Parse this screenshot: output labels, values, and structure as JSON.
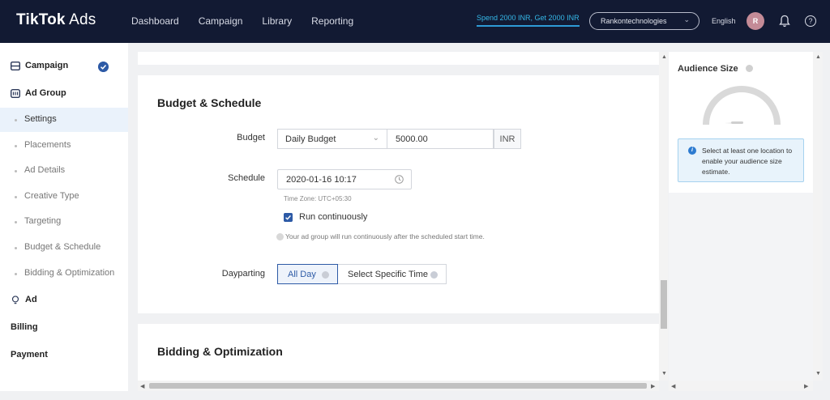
{
  "header": {
    "logo_main": "TikTok",
    "logo_sub": " Ads",
    "nav": [
      "Dashboard",
      "Campaign",
      "Library",
      "Reporting"
    ],
    "promo": "Spend 2000 INR, Get 2000 INR",
    "account": "Rankontechnologies",
    "language": "English",
    "avatar_initial": "R"
  },
  "sidebar": {
    "campaign": "Campaign",
    "ad_group": "Ad Group",
    "sub_items": [
      "Settings",
      "Placements",
      "Ad Details",
      "Creative Type",
      "Targeting",
      "Budget & Schedule",
      "Bidding & Optimization"
    ],
    "active_sub": "Settings",
    "ad": "Ad",
    "billing": "Billing",
    "payment": "Payment"
  },
  "budget_schedule": {
    "title": "Budget & Schedule",
    "budget_label": "Budget",
    "budget_type": "Daily Budget",
    "budget_value": "5000.00",
    "currency": "INR",
    "schedule_label": "Schedule",
    "schedule_value": "2020-01-16 10:17",
    "timezone": "Time Zone: UTC+05:30",
    "run_continuously": "Run continuously",
    "hint": "Your ad group will run continuously after the scheduled start time.",
    "dayparting_label": "Dayparting",
    "dayparting_all": "All Day",
    "dayparting_specific": "Select Specific Time"
  },
  "bidding": {
    "title": "Bidding & Optimization"
  },
  "audience": {
    "title": "Audience Size",
    "message": "Select at least one location to enable your audience size estimate."
  },
  "colors": {
    "topbar": "#121a33",
    "accent": "#2d5aa6",
    "promo": "#35b8e8"
  }
}
